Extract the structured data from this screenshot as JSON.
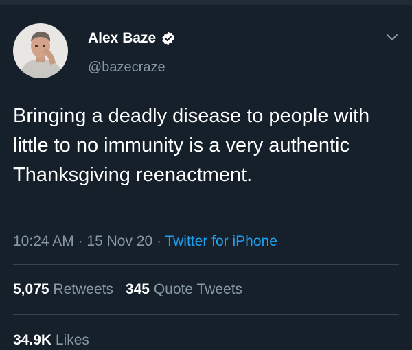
{
  "tweet": {
    "author_name": "Alex Baze",
    "author_handle": "@bazecraze",
    "text": "Bringing a deadly disease to people with little to no immunity is a very authentic Thanksgiving reenactment.",
    "time": "10:24 AM",
    "date": "15 Nov 20",
    "source": "Twitter for iPhone",
    "separator": "·"
  },
  "stats": {
    "retweets_count": "5,075",
    "retweets_label": "Retweets",
    "quotes_count": "345",
    "quotes_label": "Quote Tweets",
    "likes_count": "34.9K",
    "likes_label": "Likes"
  },
  "icons": {
    "verified": "verified-badge-icon",
    "menu": "chevron-down-icon"
  },
  "colors": {
    "background": "#15202b",
    "secondary_text": "#8899a6",
    "link": "#1da1f2",
    "divider": "#38444d"
  }
}
